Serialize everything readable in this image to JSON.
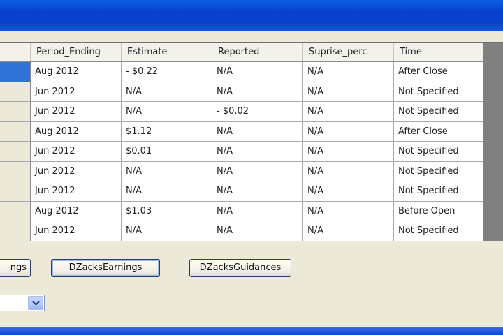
{
  "grid": {
    "columns": [
      "Period_Ending",
      "Estimate",
      "Reported",
      "Suprise_perc",
      "Time"
    ],
    "rows": [
      [
        "Aug  2012",
        "- $0.22",
        "N/A",
        "N/A",
        "After Close"
      ],
      [
        "Jun  2012",
        "N/A",
        "N/A",
        "N/A",
        "Not Specified"
      ],
      [
        "Jun  2012",
        "N/A",
        "- $0.02",
        "N/A",
        "Not Specified"
      ],
      [
        "Aug  2012",
        "$1.12",
        "N/A",
        "N/A",
        "After Close"
      ],
      [
        "Jun  2012",
        "$0.01",
        "N/A",
        "N/A",
        "Not Specified"
      ],
      [
        "Jun  2012",
        "N/A",
        "N/A",
        "N/A",
        "Not Specified"
      ],
      [
        "Jun  2012",
        "N/A",
        "N/A",
        "N/A",
        "Not Specified"
      ],
      [
        "Aug  2012",
        "$1.03",
        "N/A",
        "N/A",
        "Before Open"
      ],
      [
        "Jun  2012",
        "N/A",
        "N/A",
        "N/A",
        "Not Specified"
      ]
    ]
  },
  "buttons": {
    "left_partial": "ngs",
    "earnings": "DZacksEarnings",
    "guidances": "DZacksGuidances"
  },
  "colors": {
    "selection": "#2f73d7",
    "titlebar": "#0a3ed0",
    "background": "#ece9d8"
  },
  "icons": {
    "combo_arrow": "chevron-down-icon"
  }
}
